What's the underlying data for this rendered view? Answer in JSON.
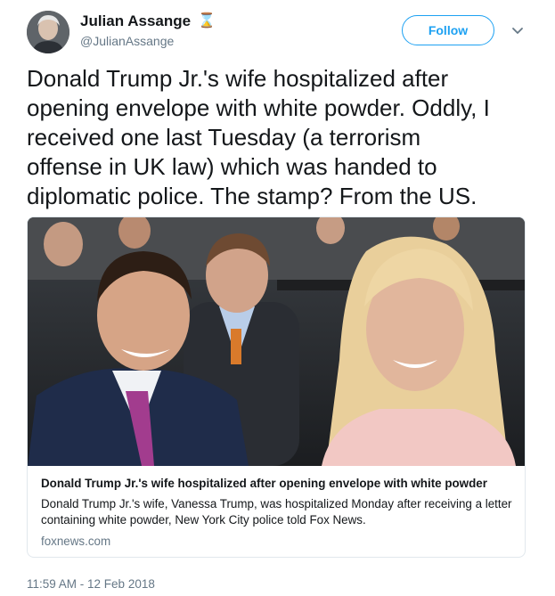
{
  "user": {
    "name": "Julian Assange",
    "handle": "@JulianAssange",
    "badge_icon": "hourglass-icon"
  },
  "follow": {
    "label": "Follow"
  },
  "caret": {
    "icon": "chevron-down-icon"
  },
  "tweet": {
    "text": "Donald Trump Jr.'s wife hospitalized after\nopening envelope with white powder. Oddly, I\nreceived one last Tuesday (a terrorism\noffense in UK law) which was handed to\ndiplomatic police. The stamp? From the US."
  },
  "card": {
    "title": "Donald Trump Jr.'s wife hospitalized after opening envelope with white powder",
    "description": "Donald Trump Jr.'s wife, Vanessa Trump, was hospitalized Monday after receiving a letter containing white powder, New York City police told Fox News.",
    "domain": "foxnews.com"
  },
  "timestamp": "11:59 AM - 12 Feb 2018",
  "colors": {
    "accent": "#1da1f2",
    "text_primary": "#14171a",
    "text_secondary": "#657786",
    "border": "#e1e8ed",
    "badge": "#e8a317"
  }
}
